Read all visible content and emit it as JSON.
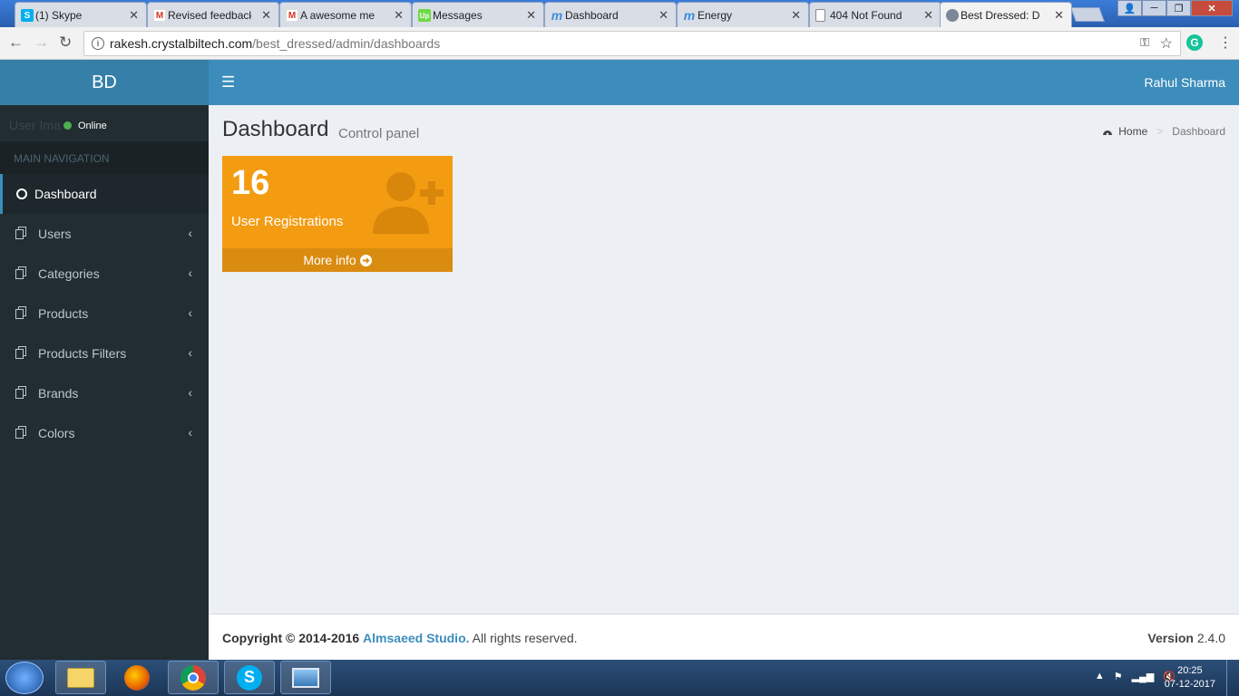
{
  "browser": {
    "tabs": [
      {
        "title": "(1) Skype",
        "favicon": "skype-icon",
        "color": "#00aff0",
        "glyph": "S"
      },
      {
        "title": "Revised feedback",
        "favicon": "gmail-icon",
        "color": "#d93025",
        "glyph": "M"
      },
      {
        "title": "A awesome me",
        "favicon": "gmail-icon",
        "color": "#d93025",
        "glyph": "M"
      },
      {
        "title": "Messages",
        "favicon": "upwork-icon",
        "color": "#6fda44",
        "glyph": "Up"
      },
      {
        "title": "Dashboard",
        "favicon": "m-logo-icon",
        "color": "#3b8de0",
        "glyph": "m"
      },
      {
        "title": "Energy",
        "favicon": "m-logo-icon",
        "color": "#3b8de0",
        "glyph": "m"
      },
      {
        "title": "404 Not Found",
        "favicon": "page-icon",
        "color": "#999999",
        "glyph": ""
      },
      {
        "title": "Best Dressed: D",
        "favicon": "db-icon",
        "color": "#7a8799",
        "glyph": "",
        "active": true
      }
    ],
    "url_host": "rakesh.crystalbiltech.com",
    "url_path": "/best_dressed/admin/dashboards"
  },
  "app": {
    "logo": "BD",
    "user_name": "Rahul Sharma",
    "user_status": "Online",
    "user_ghost_text": "User Ima"
  },
  "sidebar": {
    "header": "MAIN NAVIGATION",
    "items": [
      {
        "label": "Dashboard",
        "active": true
      },
      {
        "label": "Users"
      },
      {
        "label": "Categories"
      },
      {
        "label": "Products"
      },
      {
        "label": "Products Filters"
      },
      {
        "label": "Brands"
      },
      {
        "label": "Colors"
      }
    ]
  },
  "page": {
    "title": "Dashboard",
    "subtitle": "Control panel",
    "breadcrumb_home": "Home",
    "breadcrumb_current": "Dashboard",
    "breadcrumb_sep": ">"
  },
  "stat_box": {
    "value": "16",
    "label": "User Registrations",
    "more": "More info",
    "color": "#f39c12"
  },
  "footer": {
    "copyright": "Copyright © 2014-2016",
    "company": "Almsaeed Studio.",
    "rights": "All rights reserved.",
    "version_label": "Version",
    "version": "2.4.0"
  },
  "taskbar": {
    "time": "20:25",
    "date": "07-12-2017"
  }
}
